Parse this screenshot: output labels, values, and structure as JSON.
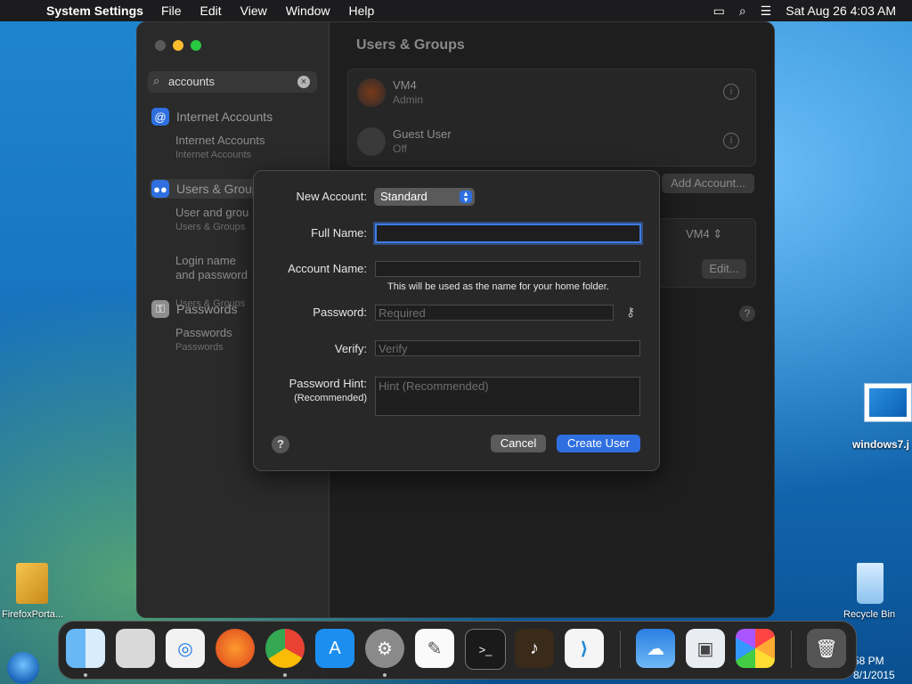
{
  "menubar": {
    "app": "System Settings",
    "items": [
      "File",
      "Edit",
      "View",
      "Window",
      "Help"
    ],
    "datetime": "Sat Aug 26  4:03 AM"
  },
  "sidebar": {
    "search_value": "accounts",
    "sections": [
      {
        "title": "Internet Accounts",
        "results": [
          {
            "label": "Internet Accounts",
            "caption": "Internet Accounts"
          }
        ]
      },
      {
        "title": "Users & Groups",
        "results": [
          {
            "label": "User and grou",
            "caption": "Users & Groups"
          },
          {
            "label": "Login name\nand password",
            "caption": "Users & Groups"
          }
        ]
      },
      {
        "title": "Passwords",
        "results": [
          {
            "label": "Passwords",
            "caption": "Passwords"
          }
        ]
      }
    ]
  },
  "content": {
    "title": "Users & Groups",
    "users": [
      {
        "name": "VM4",
        "role": "Admin"
      },
      {
        "name": "Guest User",
        "role": "Off"
      }
    ],
    "add_account_label": "Add Account...",
    "auto_login_value": "VM4",
    "edit_label": "Edit..."
  },
  "dialog": {
    "new_account_label": "New Account:",
    "account_type": "Standard",
    "full_name_label": "Full Name:",
    "full_name_value": "",
    "account_name_label": "Account Name:",
    "account_name_value": "",
    "account_name_hint": "This will be used as the name for your home folder.",
    "password_label": "Password:",
    "password_placeholder": "Required",
    "verify_label": "Verify:",
    "verify_placeholder": "Verify",
    "hint_label": "Password Hint:",
    "hint_label_sub": "(Recommended)",
    "hint_placeholder": "Hint (Recommended)",
    "cancel_label": "Cancel",
    "create_label": "Create User"
  },
  "desktop": {
    "file_label": "windows7.j",
    "firefox_label": "FirefoxPorta...",
    "recycle_label": "Recycle Bin",
    "taskbar_time": "58 PM",
    "taskbar_date": "8/1/2015"
  },
  "dock": {
    "apps": [
      "Finder",
      "Launchpad",
      "Safari",
      "Firefox",
      "Chrome",
      "App Store",
      "System Settings",
      "TextEdit",
      "Terminal",
      "GarageBand",
      "VS Code",
      "Weather",
      "Preview",
      "Photos",
      "Trash"
    ]
  },
  "colors": {
    "accent": "#2f6fe0",
    "menubar": "#1c1c1e",
    "window": "#1e1e1e",
    "dialog": "#282828"
  }
}
